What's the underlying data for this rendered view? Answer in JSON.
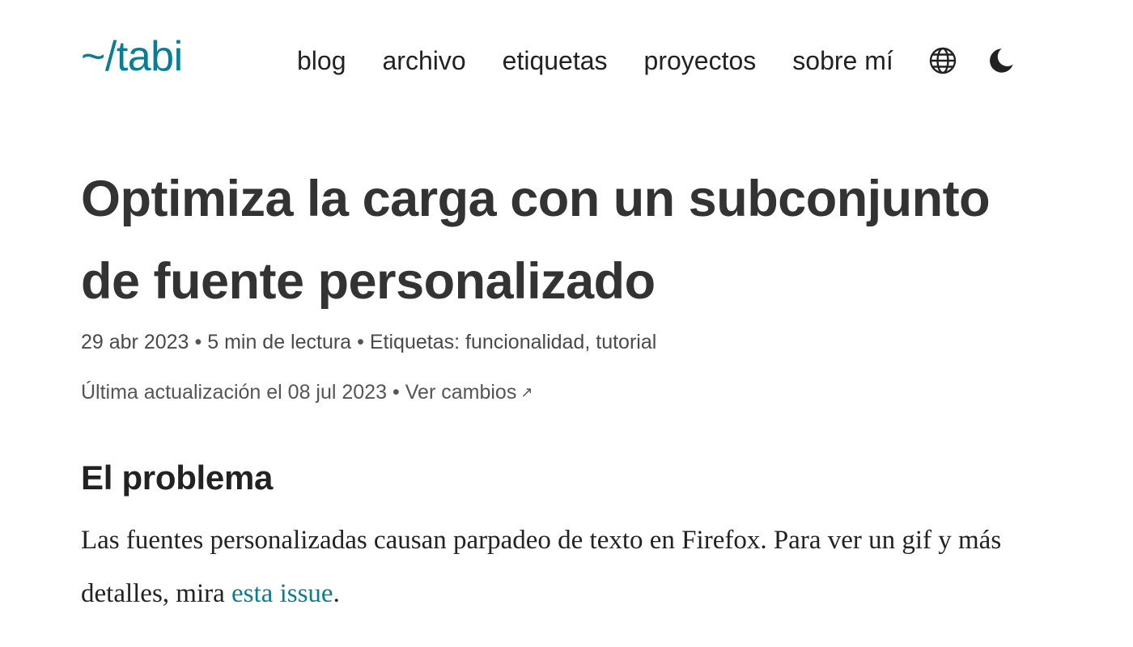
{
  "site": {
    "logo": "~/tabi",
    "accent_color": "#087e96"
  },
  "nav": {
    "items": [
      {
        "label": "blog"
      },
      {
        "label": "archivo"
      },
      {
        "label": "etiquetas"
      },
      {
        "label": "proyectos"
      },
      {
        "label": "sobre mí"
      }
    ],
    "language_icon": "globe-icon",
    "theme_icon": "moon-icon"
  },
  "post": {
    "title_line1": "Optimiza la carga con un subconjunto",
    "title_line2": "de fuente personalizado",
    "date": "29 abr 2023",
    "separator": "•",
    "reading_time": "5 min de lectura",
    "tags_label": "Etiquetas:",
    "tags": [
      "funcionalidad",
      "tutorial"
    ],
    "tags_joiner": ", ",
    "updated": "Última actualización el 08 jul 2023",
    "changes_label": "Ver cambios",
    "changes_icon": "external-link-arrow-icon"
  },
  "section": {
    "heading": "El problema",
    "para_text": "Las fuentes personalizadas causan parpadeo de texto en Firefox. Para ver un gif y más detalles, mira",
    "para_link": "esta issue",
    "para_end": "."
  }
}
